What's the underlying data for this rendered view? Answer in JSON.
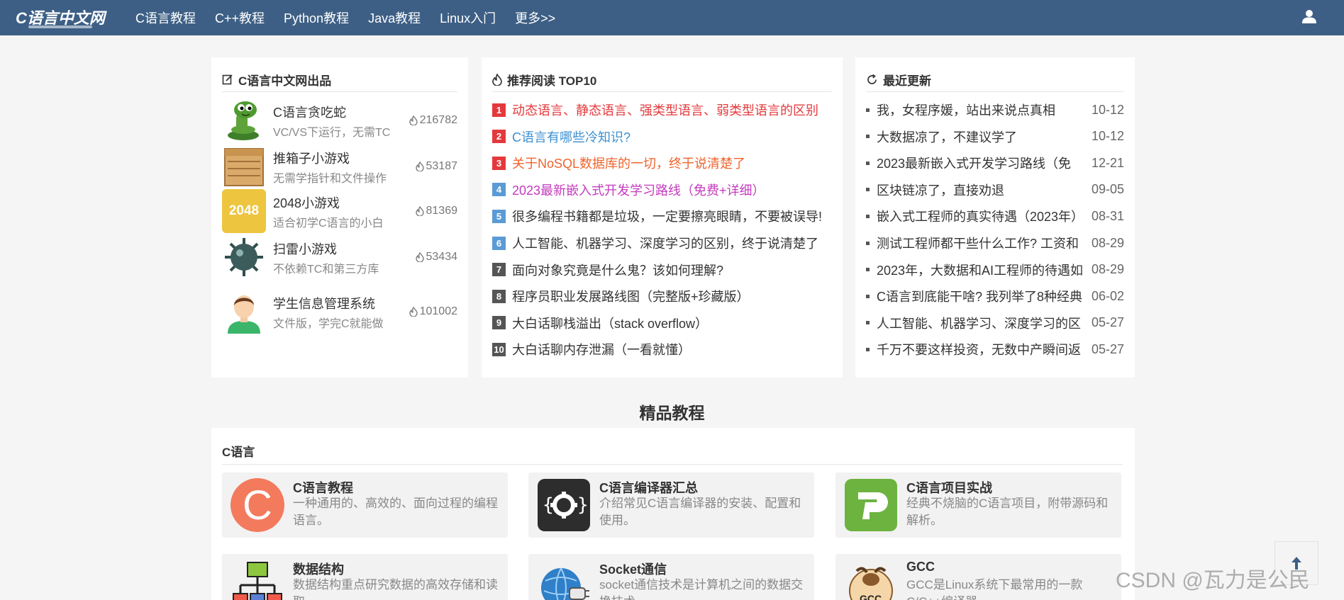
{
  "brand": {
    "logo_text": "C语言中文网"
  },
  "nav": {
    "items": [
      "C语言教程",
      "C++教程",
      "Python教程",
      "Java教程",
      "Linux入门",
      "更多>>"
    ]
  },
  "products": {
    "title": "C语言中文网出品",
    "items": [
      {
        "name": "C语言贪吃蛇",
        "desc": "VC/VS下运行，无需TC",
        "views": "216782"
      },
      {
        "name": "推箱子小游戏",
        "desc": "无需学指针和文件操作",
        "views": "53187"
      },
      {
        "name": "2048小游戏",
        "desc": "适合初学C语言的小白",
        "views": "81369",
        "badge": "2048"
      },
      {
        "name": "扫雷小游戏",
        "desc": "不依赖TC和第三方库",
        "views": "53434"
      },
      {
        "name": "学生信息管理系统",
        "desc": "文件版，学完C就能做",
        "views": "101002"
      }
    ]
  },
  "top10": {
    "title": "推荐阅读 TOP10",
    "items": [
      {
        "rank": "1",
        "text": "动态语言、静态语言、强类型语言、弱类型语言的区别",
        "color": "#e4393c",
        "rank_color": "#e4393c"
      },
      {
        "rank": "2",
        "text": "C语言有哪些冷知识?",
        "color": "#3b8fd0",
        "rank_color": "#e4393c"
      },
      {
        "rank": "3",
        "text": "关于NoSQL数据库的一切，终于说清楚了",
        "color": "#f0642d",
        "rank_color": "#e4393c"
      },
      {
        "rank": "4",
        "text": "2023最新嵌入式开发学习路线（免费+详细）",
        "color": "#c43bbf",
        "rank_color": "#5b9bd5"
      },
      {
        "rank": "5",
        "text": "很多编程书籍都是垃圾，一定要擦亮眼睛，不要被误导!",
        "color": "#333333",
        "rank_color": "#5b9bd5"
      },
      {
        "rank": "6",
        "text": "人工智能、机器学习、深度学习的区别，终于说清楚了",
        "color": "#333333",
        "rank_color": "#5b9bd5"
      },
      {
        "rank": "7",
        "text": "面向对象究竟是什么鬼？该如何理解?",
        "color": "#333333",
        "rank_color": "#555555"
      },
      {
        "rank": "8",
        "text": "程序员职业发展路线图（完整版+珍藏版）",
        "color": "#333333",
        "rank_color": "#555555"
      },
      {
        "rank": "9",
        "text": "大白话聊栈溢出（stack overflow）",
        "color": "#333333",
        "rank_color": "#555555"
      },
      {
        "rank": "10",
        "text": "大白话聊内存泄漏（一看就懂）",
        "color": "#333333",
        "rank_color": "#555555"
      }
    ]
  },
  "latest": {
    "title": "最近更新",
    "items": [
      {
        "text": "我，女程序媛，站出来说点真相",
        "date": "10-12"
      },
      {
        "text": "大数据凉了，不建议学了",
        "date": "10-12"
      },
      {
        "text": "2023最新嵌入式开发学习路线（免",
        "date": "12-21"
      },
      {
        "text": "区块链凉了，直接劝退",
        "date": "09-05"
      },
      {
        "text": "嵌入式工程师的真实待遇（2023年）",
        "date": "08-31"
      },
      {
        "text": "测试工程师都干些什么工作? 工资和",
        "date": "08-29"
      },
      {
        "text": "2023年，大数据和AI工程师的待遇如",
        "date": "08-29"
      },
      {
        "text": "C语言到底能干啥? 我列举了8种经典",
        "date": "06-02"
      },
      {
        "text": "人工智能、机器学习、深度学习的区",
        "date": "05-27"
      },
      {
        "text": "千万不要这样投资，无数中产瞬间返",
        "date": "05-27"
      }
    ]
  },
  "tutorials": {
    "heading": "精品教程",
    "category": "C语言",
    "cards": [
      {
        "name": "C语言教程",
        "desc": "一种通用的、高效的、面向过程的编程语言。",
        "icon": "c-language-icon",
        "badge": "C"
      },
      {
        "name": "C语言编译器汇总",
        "desc": "介绍常见C语言编译器的安装、配置和使用。",
        "icon": "compiler-gear-icon"
      },
      {
        "name": "C语言项目实战",
        "desc": "经典不烧脑的C语言项目，附带源码和解析。",
        "icon": "project-p-icon"
      },
      {
        "name": "数据结构",
        "desc": "数据结构重点研究数据的高效存储和读取。",
        "icon": "data-structure-icon"
      },
      {
        "name": "Socket通信",
        "desc": "socket通信技术是计算机之间的数据交换技术。",
        "icon": "socket-globe-icon"
      },
      {
        "name": "GCC",
        "desc": "GCC是Linux系统下最常用的一款C/C++编译器。",
        "icon": "gcc-gnu-icon",
        "badge": "GCC"
      }
    ]
  },
  "watermark": "CSDN @瓦力是公民",
  "colors": {
    "topbar": "#3d5f85",
    "accent_red": "#e4393c"
  }
}
